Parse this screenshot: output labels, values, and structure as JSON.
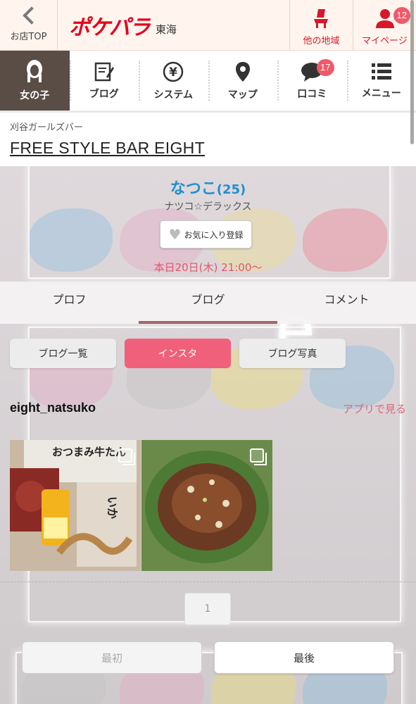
{
  "header": {
    "back_label": "お店TOP",
    "logo_text": "ポケパラ",
    "region": "東海",
    "other_region_label": "他の地域",
    "mypage_label": "マイページ",
    "mypage_badge": "12",
    "brand_color": "#e5001c"
  },
  "nav": {
    "items": [
      {
        "label": "女の子",
        "icon": "girl-icon",
        "active": true
      },
      {
        "label": "ブログ",
        "icon": "blog-icon"
      },
      {
        "label": "システム",
        "icon": "yen-icon"
      },
      {
        "label": "マップ",
        "icon": "map-pin-icon"
      },
      {
        "label": "口コミ",
        "icon": "speech-bubble-icon",
        "badge": "17"
      },
      {
        "label": "メニュー",
        "icon": "menu-list-icon"
      }
    ]
  },
  "shop": {
    "category": "刈谷ガールズバー",
    "name": "FREE STYLE BAR EIGHT"
  },
  "profile": {
    "name": "なつこ",
    "age": "(25)",
    "catchphrase": "ナツコ☆デラックス",
    "favorite_label": "お気に入り登録",
    "schedule": "本日20日(木) 21:00〜"
  },
  "tabs": {
    "items": [
      "プロフ",
      "ブログ",
      "コメント"
    ],
    "active_index": 1
  },
  "subtabs": {
    "items": [
      "ブログ一覧",
      "インスタ",
      "ブログ写真"
    ],
    "active_index": 1
  },
  "instagram": {
    "username": "eight_natsuko",
    "app_link": "アプリで見る",
    "photo1": {
      "snack_pkg": "おつまみ牛たん",
      "label_text": "いか"
    }
  },
  "pagination": {
    "current_page": "1",
    "first_label": "最初",
    "last_label": "最後"
  },
  "colors": {
    "accent_pink": "#f0607a",
    "name_blue": "#1f8fd0",
    "nav_active": "#5a4d46"
  }
}
